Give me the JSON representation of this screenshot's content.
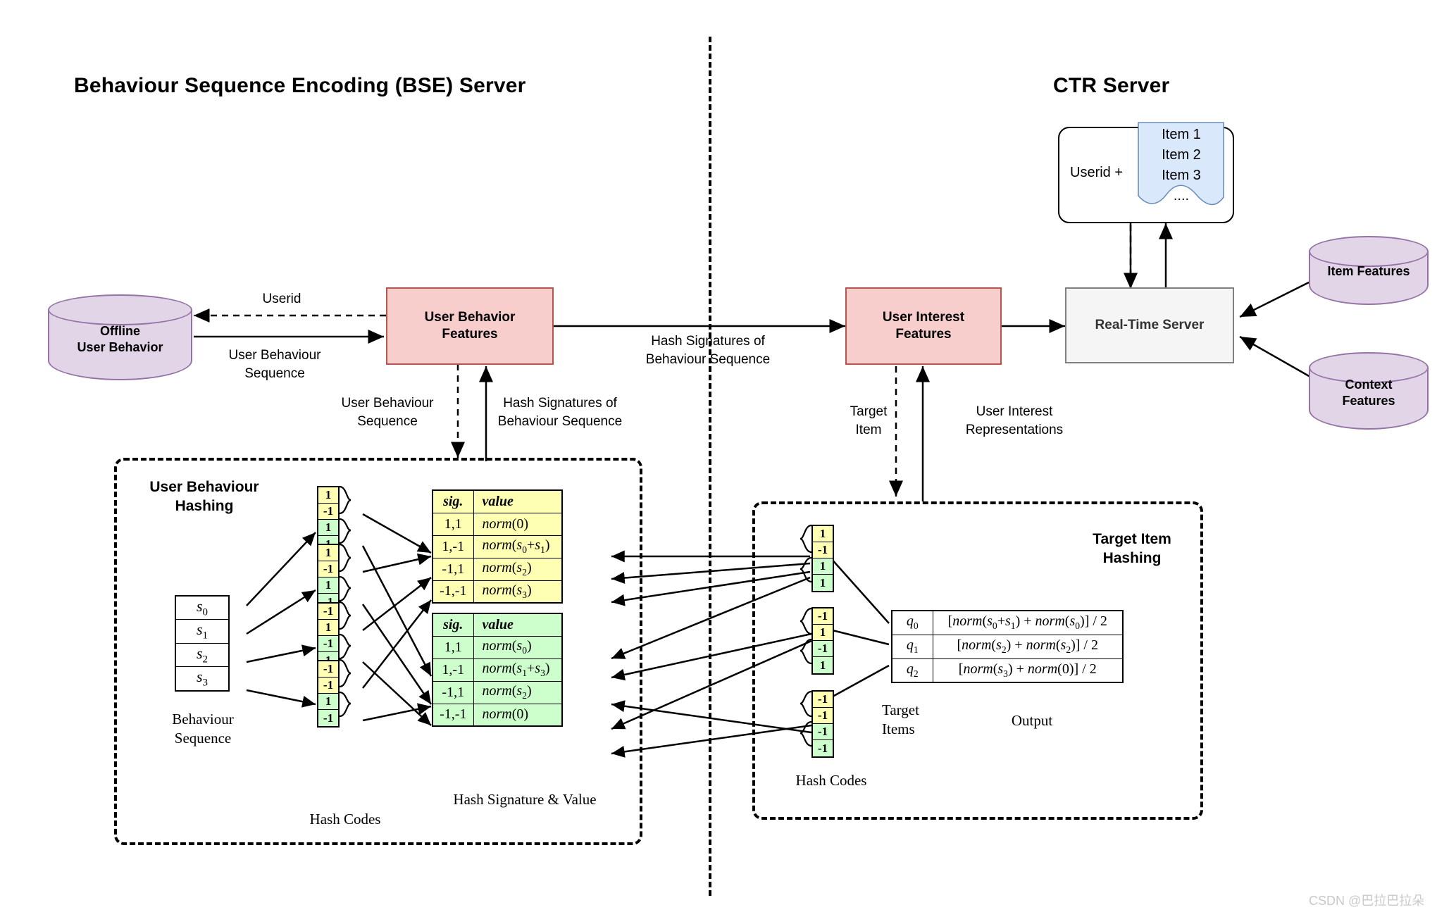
{
  "titles": {
    "left_server": "Behaviour Sequence Encoding (BSE) Server",
    "right_server": "CTR Server"
  },
  "nodes": {
    "offline_user_behavior": "Offline\nUser Behavior",
    "user_behavior_features": "User Behavior\nFeatures",
    "user_interest_features": "User Interest\nFeatures",
    "real_time_server": "Real-Time Server",
    "item_features": "Item Features",
    "context_features": "Context\nFeatures"
  },
  "request_card": {
    "userid_label": "Userid +",
    "items": [
      "Item 1",
      "Item 2",
      "Item 3",
      "...."
    ]
  },
  "edge_labels": {
    "userid": "Userid",
    "user_behaviour_sequence_left": "User Behaviour\nSequence",
    "user_behaviour_sequence_down": "User Behaviour\nSequence",
    "hash_signatures_up": "Hash Signatures of\nBehaviour Sequence",
    "hash_signatures_mid": "Hash Signatures of\nBehaviour Sequence",
    "target_item": "Target\nItem",
    "user_interest_representations": "User Interest\nRepresentations"
  },
  "user_behaviour_hashing": {
    "title": "User Behaviour\nHashing",
    "sequence_caption": "Behaviour\nSequence",
    "hash_codes_caption": "Hash Codes",
    "signature_caption": "Hash Signature & Value",
    "sequence": [
      "s0",
      "s1",
      "s2",
      "s3"
    ],
    "hash_codes": [
      {
        "values": [
          "1",
          "-1",
          "1",
          "1"
        ],
        "colors": [
          "y",
          "y",
          "g",
          "g"
        ]
      },
      {
        "values": [
          "1",
          "-1",
          "1",
          "-1"
        ],
        "colors": [
          "y",
          "y",
          "g",
          "g"
        ]
      },
      {
        "values": [
          "-1",
          "1",
          "-1",
          "1"
        ],
        "colors": [
          "y",
          "y",
          "g",
          "g"
        ]
      },
      {
        "values": [
          "-1",
          "-1",
          "1",
          "-1"
        ],
        "colors": [
          "y",
          "y",
          "g",
          "g"
        ]
      }
    ],
    "table_yellow": {
      "headers": [
        "sig.",
        "value"
      ],
      "rows": [
        {
          "sig": "1,1",
          "value_fn": "norm",
          "value_arg": "(0)"
        },
        {
          "sig": "1,-1",
          "value_fn": "norm",
          "value_arg": "(s0+s1)"
        },
        {
          "sig": "-1,1",
          "value_fn": "norm",
          "value_arg": "(s2)"
        },
        {
          "sig": "-1,-1",
          "value_fn": "norm",
          "value_arg": "(s3)"
        }
      ]
    },
    "table_green": {
      "headers": [
        "sig.",
        "value"
      ],
      "rows": [
        {
          "sig": "1,1",
          "value_fn": "norm",
          "value_arg": "(s0)"
        },
        {
          "sig": "1,-1",
          "value_fn": "norm",
          "value_arg": "(s1+s3)"
        },
        {
          "sig": "-1,1",
          "value_fn": "norm",
          "value_arg": "(s2)"
        },
        {
          "sig": "-1,-1",
          "value_fn": "norm",
          "value_arg": "(0)"
        }
      ]
    }
  },
  "target_item_hashing": {
    "title": "Target Item\nHashing",
    "hash_codes_caption": "Hash Codes",
    "target_items_caption": "Target\nItems",
    "output_caption": "Output",
    "hash_codes": [
      {
        "values": [
          "1",
          "-1",
          "1",
          "1"
        ],
        "colors": [
          "y",
          "y",
          "g",
          "g"
        ]
      },
      {
        "values": [
          "-1",
          "1",
          "-1",
          "1"
        ],
        "colors": [
          "y",
          "y",
          "g",
          "g"
        ]
      },
      {
        "values": [
          "-1",
          "-1",
          "-1",
          "-1"
        ],
        "colors": [
          "y",
          "y",
          "g",
          "g"
        ]
      }
    ],
    "rows": [
      {
        "key": "q0",
        "expr": "[norm(s0+s1) + norm(s0)] / 2"
      },
      {
        "key": "q1",
        "expr": "[norm(s2) + norm(s2)] / 2"
      },
      {
        "key": "q2",
        "expr": "[norm(s3) + norm(0)] / 2"
      }
    ]
  },
  "watermark": "CSDN @巴拉巴拉朵",
  "colors": {
    "node_fill": "#f8cecc",
    "node_stroke": "#b85450",
    "cylinder_fill": "#e1d5e7",
    "cylinder_stroke": "#9673a6",
    "grey_fill": "#f5f5f5",
    "grey_stroke": "#808080",
    "hash_yellow": "#ffffb3",
    "hash_green": "#ccffcc",
    "item_blue": "#dae8fc"
  }
}
